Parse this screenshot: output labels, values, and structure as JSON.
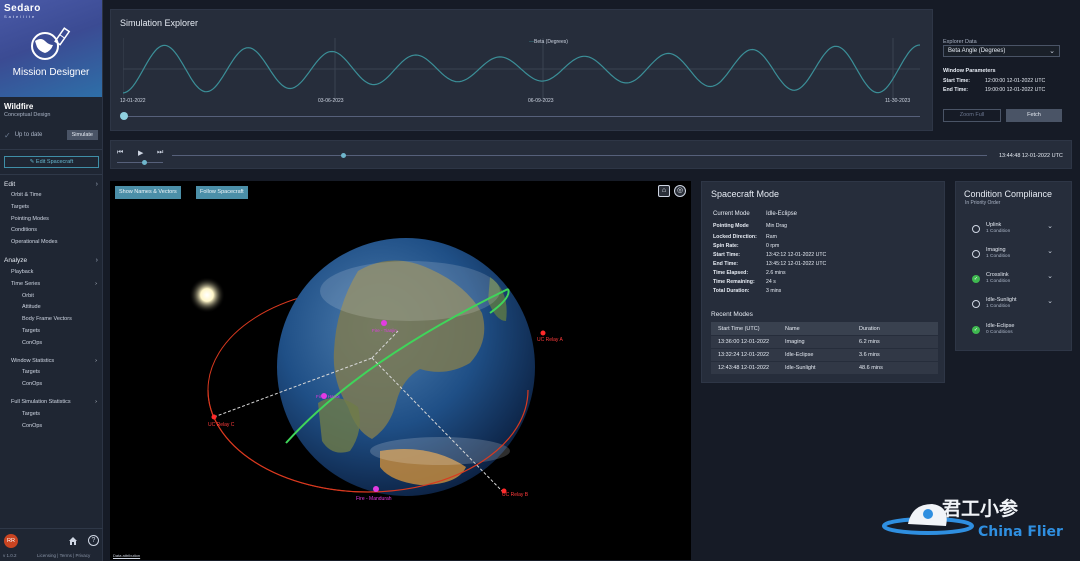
{
  "brand": {
    "logo": "Sedaro",
    "tagline": "Satellite",
    "app_name": "Mission Designer"
  },
  "project": {
    "name": "Wildfire",
    "phase": "Conceptual Design"
  },
  "status": {
    "text": "Up to date",
    "simulate_label": "Simulate"
  },
  "edit_spacecraft_label": "Edit Spacecraft",
  "nav": {
    "edit": {
      "label": "Edit",
      "items": [
        "Orbit & Time",
        "Targets",
        "Pointing Modes",
        "Conditions",
        "Operational Modes"
      ]
    },
    "analyze": {
      "label": "Analyze",
      "playback": "Playback",
      "time_series": "Time Series",
      "time_series_items": [
        "Orbit",
        "Attitude",
        "Body Frame Vectors",
        "Targets",
        "ConOps"
      ],
      "window_stats": "Window Statistics",
      "window_stats_items": [
        "Targets",
        "ConOps"
      ],
      "full_stats": "Full Simulation Statistics",
      "full_stats_items": [
        "Targets",
        "ConOps"
      ]
    }
  },
  "footer": {
    "avatar": "RR",
    "version": "v 1.0.2",
    "links": "Licensing | Terms | Privacy"
  },
  "explorer": {
    "title": "Simulation Explorer",
    "series_label": "Beta (Degrees)",
    "x_ticks": [
      "12-01-2022",
      "03-06-2023",
      "06-09-2023",
      "11-30-2023"
    ],
    "data_label": "Explorer Data",
    "data_value": "Beta Angle (Degrees)",
    "window_title": "Window Parameters",
    "start_label": "Start Time:",
    "start_value": "12:00:00 12-01-2022 UTC",
    "end_label": "End Time:",
    "end_value": "19:00:00 12-01-2022 UTC",
    "zoom_label": "Zoom Full",
    "fetch_label": "Fetch",
    "line_color": "#3b8f98"
  },
  "playback": {
    "time": "13:44:48 12-01-2022 UTC",
    "progress": 0.21
  },
  "viewer": {
    "show_names_label": "Show Names & Vectors",
    "follow_label": "Follow Spacecraft",
    "attribution": "Data attribution",
    "labels": {
      "relay_a": "UC Relay A",
      "relay_c": "UC Relay C",
      "relay_b": "UC Relay B",
      "fire_mandurah": "Fire - Mandurah",
      "fire_upper": "Fire - Tianjin",
      "fire_mid": "Fire - Hanoi"
    }
  },
  "spacecraft_mode": {
    "title": "Spacecraft Mode",
    "current_mode_label": "Current Mode",
    "current_mode": "Idle-Eclipse",
    "rows": [
      {
        "k": "Pointing Mode",
        "v": "Min Drag"
      },
      {
        "k": "Locked Direction:",
        "v": "Ram"
      },
      {
        "k": "Spin Rate:",
        "v": "0 rpm"
      },
      {
        "k": "Start Time:",
        "v": "13:42:12 12-01-2022 UTC"
      },
      {
        "k": "End Time:",
        "v": "13:45:12 12-01-2022 UTC"
      },
      {
        "k": "Time Elapsed:",
        "v": "2.6 mins"
      },
      {
        "k": "Time Remaining:",
        "v": "24 s"
      },
      {
        "k": "Total Duration:",
        "v": "3 mins"
      }
    ],
    "recent_title": "Recent Modes",
    "table_headers": [
      "Start Time (UTC)",
      "Name",
      "Duration"
    ],
    "table_rows": [
      [
        "13:36:00 12-01-2022",
        "Imaging",
        "6.2 mins"
      ],
      [
        "13:32:24 12-01-2022",
        "Idle-Eclipse",
        "3.6 mins"
      ],
      [
        "12:43:48 12-01-2022",
        "Idle-Sunlight",
        "48.6 mins"
      ]
    ]
  },
  "compliance": {
    "title": "Condition Compliance",
    "subtitle": "In Priority Order",
    "conditions": [
      {
        "name": "Uplink",
        "count": "1 Condition",
        "ok": false
      },
      {
        "name": "Imaging",
        "count": "1 Condition",
        "ok": false
      },
      {
        "name": "Crosslink",
        "count": "1 Condition",
        "ok": true
      },
      {
        "name": "Idle-Sunlight",
        "count": "1 Condition",
        "ok": false
      },
      {
        "name": "Idle-Eclipse",
        "count": "0 Conditions",
        "ok": true
      }
    ]
  },
  "watermark": {
    "cn": "君工小参",
    "en": "China Flier"
  }
}
